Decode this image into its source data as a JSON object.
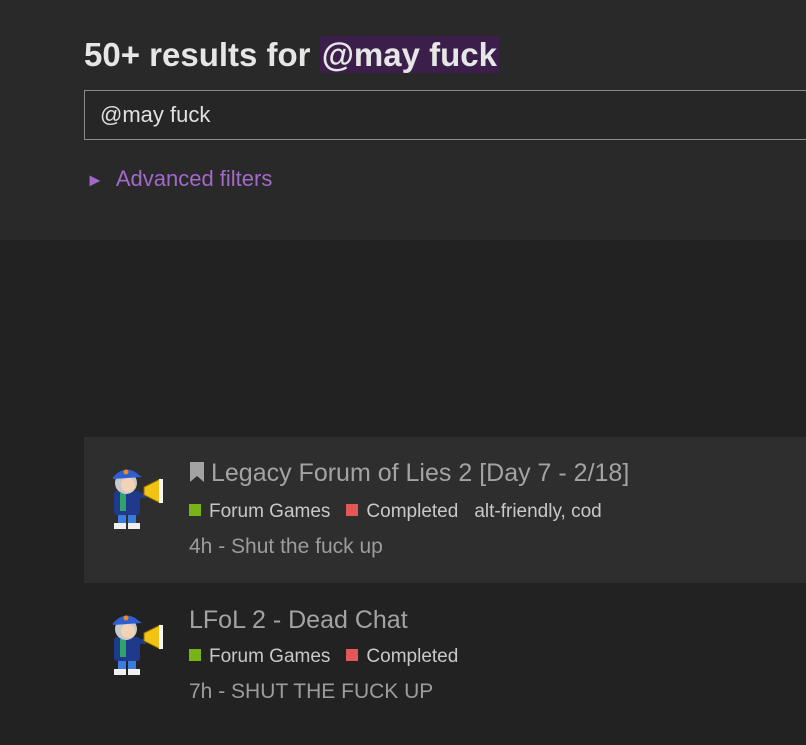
{
  "search": {
    "heading_prefix": "50+ results for",
    "heading_query": "@may fuck",
    "query_value": "@may fuck",
    "advanced_filters_label": "Advanced filters"
  },
  "colors": {
    "accent": "#a269c9",
    "category_forum_games": "#7ab317",
    "tag_completed": "#e45757"
  },
  "results": [
    {
      "title": "Legacy Forum of Lies 2 [Day 7 - 2/18]",
      "bookmarked": true,
      "category": "Forum Games",
      "status": "Completed",
      "tags": "alt-friendly, cod",
      "age": "4h",
      "separator": "-",
      "excerpt": "Shut the fuck up",
      "avatar_icon": "user-avatar-megaphone"
    },
    {
      "title": "LFoL 2 - Dead Chat",
      "bookmarked": false,
      "category": "Forum Games",
      "status": "Completed",
      "tags": "",
      "age": "7h",
      "separator": "-",
      "excerpt": "SHUT THE FUCK UP",
      "avatar_icon": "user-avatar-megaphone"
    }
  ]
}
